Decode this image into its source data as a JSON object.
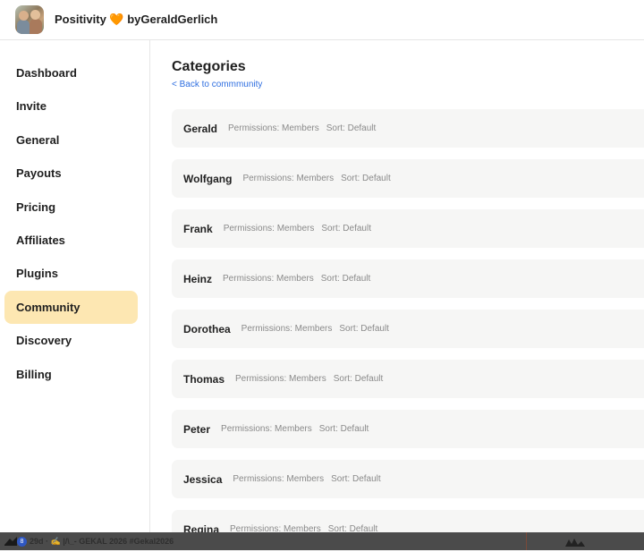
{
  "header": {
    "title": "Positivity 🧡 byGeraldGerlich"
  },
  "sidebar": {
    "items": [
      {
        "label": "Dashboard"
      },
      {
        "label": "Invite"
      },
      {
        "label": "General"
      },
      {
        "label": "Payouts"
      },
      {
        "label": "Pricing"
      },
      {
        "label": "Affiliates"
      },
      {
        "label": "Plugins"
      },
      {
        "label": "Community",
        "active": true
      },
      {
        "label": "Discovery"
      },
      {
        "label": "Billing"
      }
    ]
  },
  "main": {
    "title": "Categories",
    "back_link": "< Back to commmunity",
    "categories": [
      {
        "name": "Gerald",
        "permissions": "Permissions: Members",
        "sort": "Sort: Default"
      },
      {
        "name": "Wolfgang",
        "permissions": "Permissions: Members",
        "sort": "Sort: Default"
      },
      {
        "name": "Frank",
        "permissions": "Permissions: Members",
        "sort": "Sort: Default"
      },
      {
        "name": "Heinz",
        "permissions": "Permissions: Members",
        "sort": "Sort: Default"
      },
      {
        "name": "Dorothea",
        "permissions": "Permissions: Members",
        "sort": "Sort: Default"
      },
      {
        "name": "Thomas",
        "permissions": "Permissions: Members",
        "sort": "Sort: Default"
      },
      {
        "name": "Peter",
        "permissions": "Permissions: Members",
        "sort": "Sort: Default"
      },
      {
        "name": "Jessica",
        "permissions": "Permissions: Members",
        "sort": "Sort: Default"
      },
      {
        "name": "Regina",
        "permissions": "Permissions: Members",
        "sort": "Sort: Default"
      }
    ]
  },
  "taskbar": {
    "badge": "8",
    "text": "29d · ✍️ |/\\_- GEKAL 2026 #Gekal2026"
  },
  "colors": {
    "active_nav": "#fde7b2",
    "link": "#2f6fe0",
    "row_bg": "#f6f6f5"
  }
}
